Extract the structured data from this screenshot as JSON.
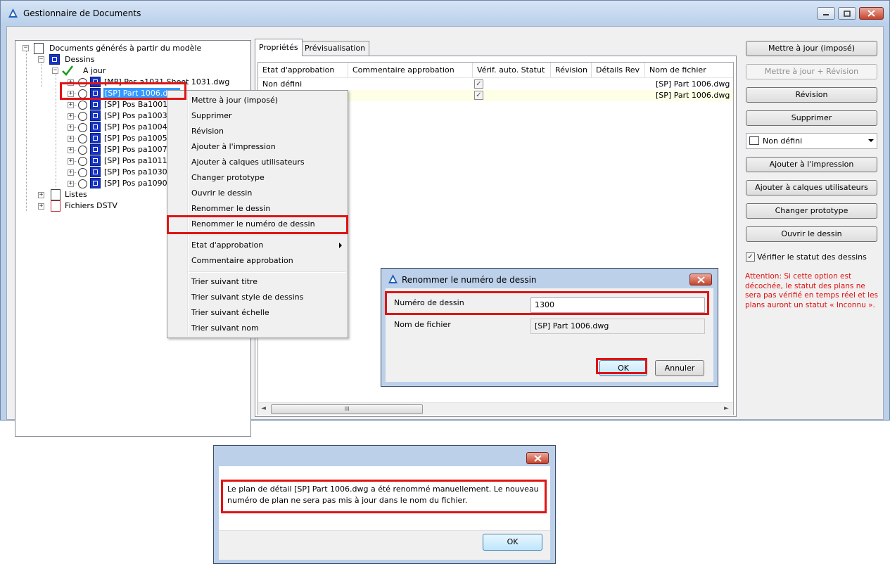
{
  "window": {
    "title": "Gestionnaire de Documents"
  },
  "tree": {
    "root": "Documents générés à partir du modèle",
    "dessins": "Dessins",
    "a_jour": "A jour",
    "items": [
      "[MP] Pos a1031 Sheet 1031.dwg",
      "[SP] Part 1006.dwg",
      "[SP] Pos Ba1001",
      "[SP] Pos pa1003",
      "[SP] Pos pa1004",
      "[SP] Pos pa1005",
      "[SP] Pos pa1007",
      "[SP] Pos pa1011",
      "[SP] Pos pa1030",
      "[SP] Pos pa1090"
    ],
    "listes": "Listes",
    "dstv": "Fichiers DSTV"
  },
  "tabs": [
    "Propriétés",
    "Prévisualisation"
  ],
  "grid": {
    "columns": [
      "Etat d'approbation",
      "Commentaire approbation",
      "Vérif. auto. Statut",
      "Révision",
      "Détails Rev",
      "Nom de fichier"
    ],
    "rows": [
      {
        "etat": "Non défini",
        "verif": true,
        "fichier": "[SP] Part 1006.dwg"
      },
      {
        "etat": "",
        "verif": true,
        "fichier": "[SP] Part 1006.dwg"
      }
    ],
    "scroll_grip": "III"
  },
  "buttons": {
    "update": "Mettre à jour (imposé)",
    "update_rev": "Mettre à jour + Révision",
    "revision": "Révision",
    "delete": "Supprimer",
    "add_print": "Ajouter à l'impression",
    "add_layers": "Ajouter à calques utilisateurs",
    "change_proto": "Changer prototype",
    "open": "Ouvrir le dessin"
  },
  "combo": {
    "value": "Non défini"
  },
  "verify": {
    "label": "Vérifier le statut des dessins",
    "checked": true
  },
  "warning": "Attention: Si cette option est décochée, le statut des plans ne sera pas vérifié en temps réel et les plans auront un statut « Inconnu ».",
  "context_menu": {
    "group1": [
      "Mettre à jour (imposé)",
      "Supprimer",
      "Révision",
      "Ajouter à l'impression",
      "Ajouter à calques utilisateurs",
      "Changer prototype",
      "Ouvrir le dessin",
      "Renommer le dessin",
      "Renommer le numéro de dessin"
    ],
    "group2": [
      "Etat d'approbation",
      "Commentaire approbation"
    ],
    "group3": [
      "Trier suivant titre",
      "Trier suivant style de dessins",
      "Trier suivant échelle",
      "Trier suivant nom"
    ]
  },
  "rename_dialog": {
    "title": "Renommer le numéro de dessin",
    "number_label": "Numéro de dessin",
    "number_value": "1300",
    "file_label": "Nom de fichier",
    "file_value": "[SP] Part 1006.dwg",
    "ok": "OK",
    "cancel": "Annuler"
  },
  "message_dialog": {
    "text_line1": "Le plan de détail [SP] Part 1006.dwg a été renommé manuellement. Le nouveau",
    "text_line2": "numéro de plan ne sera pas mis à jour dans le nom du fichier.",
    "ok": "OK"
  },
  "colors": {
    "highlight_red": "#e01414",
    "selection_blue": "#3399ff",
    "warning_red": "#e01010"
  }
}
